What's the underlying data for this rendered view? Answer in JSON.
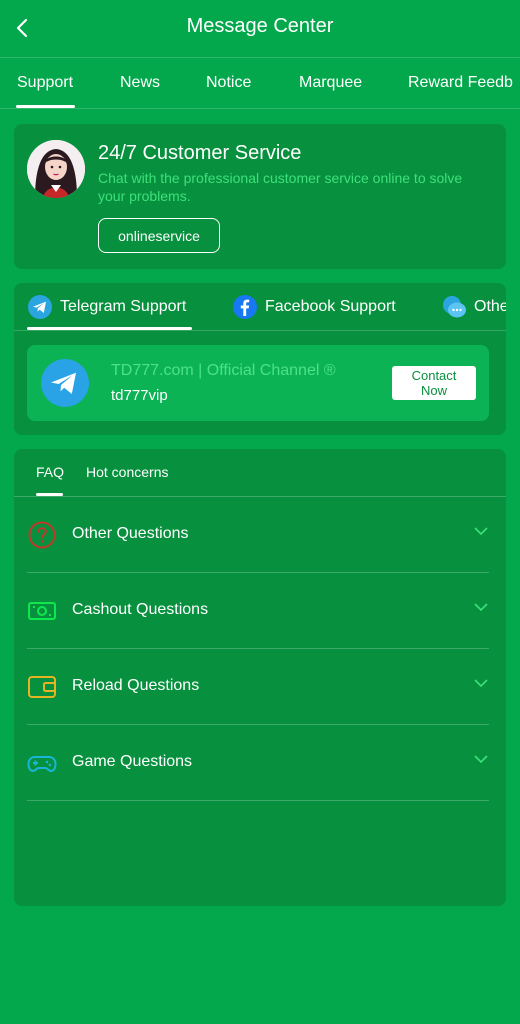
{
  "header": {
    "title": "Message Center"
  },
  "top_tabs": [
    {
      "label": "Support"
    },
    {
      "label": "News"
    },
    {
      "label": "Notice"
    },
    {
      "label": "Marquee"
    },
    {
      "label": "Reward Feedb"
    }
  ],
  "customer_service": {
    "title": "24/7 Customer Service",
    "description": "Chat with the professional customer service online to solve your problems.",
    "button_label": "onlineservice"
  },
  "support_tabs": [
    {
      "label": "Telegram Support",
      "icon": "telegram-icon"
    },
    {
      "label": "Facebook Support",
      "icon": "facebook-icon"
    },
    {
      "label": "Othe",
      "icon": "chat-bubble-icon"
    }
  ],
  "channel": {
    "name": "TD777.com | Official Channel ®",
    "handle": "td777vip",
    "contact_label": "Contact Now"
  },
  "faq_tabs": [
    {
      "label": "FAQ"
    },
    {
      "label": "Hot concerns"
    }
  ],
  "questions": [
    {
      "label": "Other Questions",
      "icon": "question-circle-icon",
      "color": "#c0392b"
    },
    {
      "label": "Cashout Questions",
      "icon": "cash-icon",
      "color": "#0ee84d"
    },
    {
      "label": "Reload Questions",
      "icon": "wallet-icon",
      "color": "#e6b422"
    },
    {
      "label": "Game Questions",
      "icon": "gamepad-icon",
      "color": "#19b5d6"
    }
  ],
  "colors": {
    "background": "#04a84c",
    "panel": "#07913e",
    "accent_text": "#3ee07a",
    "card": "#0cb355"
  }
}
